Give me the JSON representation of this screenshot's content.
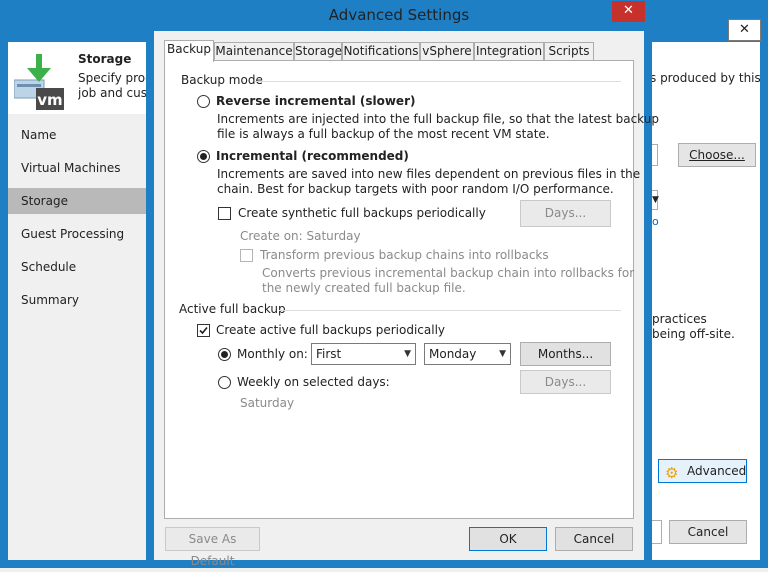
{
  "background_window": {
    "header": {
      "title": "Storage",
      "description_left": "Specify proce\njob and custo",
      "description_right": "s produced by this",
      "logo_text": "vm"
    },
    "nav": [
      "Name",
      "Virtual Machines",
      "Storage",
      "Guest Processing",
      "Schedule",
      "Summary"
    ],
    "active_nav_index": 2,
    "choose_button": "Choose...",
    "right_text_line1": "practices",
    "right_text_line2": "being off-site.",
    "small_mark": "o",
    "advanced_button": "Advanced",
    "cancel_button": "Cancel"
  },
  "dialog": {
    "title": "Advanced Settings",
    "tabs": [
      "Backup",
      "Maintenance",
      "Storage",
      "Notifications",
      "vSphere",
      "Integration",
      "Scripts"
    ],
    "active_tab_index": 0,
    "backup_mode": {
      "label": "Backup mode",
      "reverse_label": "Reverse incremental (slower)",
      "reverse_desc_1": "Increments are injected into the full backup file, so that the latest backup",
      "reverse_desc_2": "file is always a full backup of the most recent VM state.",
      "incremental_label": "Incremental (recommended)",
      "incremental_desc_1": "Increments are saved into new files dependent on previous files in the",
      "incremental_desc_2": "chain. Best for backup targets with poor random I/O performance.",
      "selected": "incremental",
      "synthetic_label": "Create synthetic full backups periodically",
      "synthetic_checked": false,
      "days_button": "Days...",
      "create_on": "Create on:  Saturday",
      "transform_label": "Transform previous backup chains into rollbacks",
      "transform_desc_1": "Converts previous incremental backup chain into rollbacks for",
      "transform_desc_2": "the newly created full backup file."
    },
    "active_full": {
      "label": "Active full backup",
      "create_label": "Create active full backups periodically",
      "create_checked": true,
      "monthly_label": "Monthly on:",
      "monthly_selected": true,
      "ordinal_value": "First",
      "weekday_value": "Monday",
      "months_button": "Months...",
      "weekly_label": "Weekly on selected days:",
      "weekly_days_button": "Days...",
      "weekly_day": "Saturday"
    },
    "footer": {
      "save_default": "Save As Default",
      "ok": "OK",
      "cancel": "Cancel"
    }
  }
}
